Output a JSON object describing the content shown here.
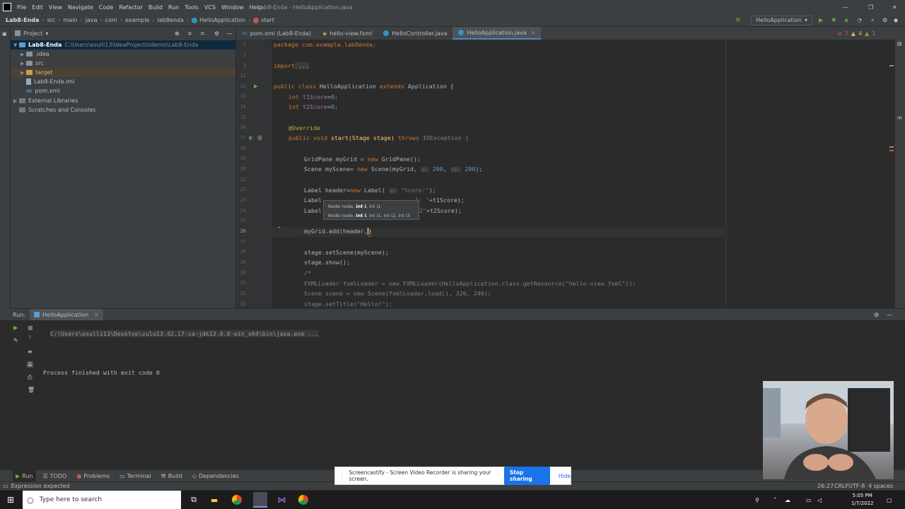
{
  "menu": [
    "File",
    "Edit",
    "View",
    "Navigate",
    "Code",
    "Refactor",
    "Build",
    "Run",
    "Tools",
    "VCS",
    "Window",
    "Help"
  ],
  "window_title": "Lab8-Enda - HelloApplication.java",
  "breadcrumbs": [
    "Lab8-Enda",
    "src",
    "main",
    "java",
    "com",
    "example",
    "lab8enda",
    "HelloApplication",
    "start"
  ],
  "run_config": "HelloApplication",
  "project": {
    "title": "Project",
    "root": "Lab8-Enda",
    "root_path": "C:\\Users\\esulli13\\IdeaProjects\\demo\\Lab8-Enda",
    "items": [
      ".idea",
      "src",
      "target",
      "Lab8-Enda.iml",
      "pom.xml"
    ],
    "external": "External Libraries",
    "scratches": "Scratches and Consoles"
  },
  "tabs": [
    "pom.xml (Lab8-Enda)",
    "hello-view.fxml",
    "HelloController.java",
    "HelloApplication.java"
  ],
  "inspections": {
    "errors": "2",
    "warnings": "4",
    "weak": "1"
  },
  "code": {
    "lines": [
      "1",
      "2",
      "3",
      "11",
      "12",
      "13",
      "14",
      "15",
      "16",
      "17",
      "18",
      "19",
      "20",
      "21",
      "22",
      "23",
      "24",
      "25",
      "26",
      "27",
      "28",
      "29",
      "30",
      "31",
      "32",
      "33"
    ],
    "l1": "package com.example.lab8enda;",
    "l3_kw": "import",
    "l3_rest": " ...",
    "l12_a": "public class ",
    "l12_b": "HelloApplication ",
    "l12_c": "extends ",
    "l12_d": "Application {",
    "l13_a": "int ",
    "l13_b": "t1Score",
    "l13_c": "=",
    "l13_d": "0",
    "l14_a": "int ",
    "l14_b": "t2Score",
    "l14_c": "=",
    "l14_d": "0",
    "l16": "@Override",
    "l17_a": "public void ",
    "l17_b": "start(Stage stage) ",
    "l17_c": "throws ",
    "l17_d": "IOException {",
    "l19_a": "GridPane myGrid = ",
    "l19_b": "new ",
    "l19_c": "GridPane();",
    "l20_a": "Scene myScene= ",
    "l20_b": "new ",
    "l20_c": "Scene(myGrid, ",
    "l20_h1": "v:",
    "l20_n1": "200",
    ", ": ", ",
    "l20_h2": "v1:",
    "l20_n2": "200",
    "l20_e": ");",
    "l22_a": "Label header=",
    "l22_b": "new ",
    "l22_c": "Label( ",
    "l22_h": "s:",
    "l22_s": "\"Score:\"",
    "l22_e": ");",
    "l23_a": "Label",
    "l23_s": "1: \"",
    "l23_e": "+t1Score);",
    "l24_a": "Label",
    "l24_s": "2\"",
    "l24_e": "+t2Score);",
    "l26_a": "myGrid.add(header,",
    "l28": "stage.setScene(myScene);",
    "l29": "stage.show();",
    "l30": "/*",
    "l31": "FXMLLoader fxmlLoader = new FXMLLoader(HelloApplication.class.getResource(\"hello-view.fxml\"));",
    "l32": "Scene scene = new Scene(fxmlLoader.load(), 320, 240);",
    "l33": "stage.setTitle(\"Hello!\");"
  },
  "tooltip": {
    "r1_a": "Node node, ",
    "r1_b": "int i",
    ", int i1": ", int i1",
    "r2_a": "Node node, ",
    "r2_b": "int i",
    "r2_c": ", int i1, int i2, int i3"
  },
  "run": {
    "label": "Run:",
    "tab": "HelloApplication",
    "cmd": "C:\\Users\\esulli13\\Desktop\\zulu13.42.17-ca-jdk13.0.8-win_x64\\bin\\java.exe ...",
    "output": "Process finished with exit code 0"
  },
  "bottom_tabs": [
    "Run",
    "TODO",
    "Problems",
    "Terminal",
    "Build",
    "Dependencies"
  ],
  "status": {
    "left": "Expression expected",
    "pos": "26:27",
    "sep": "CRLF",
    "enc": "UTF-8",
    "indent": "4 spaces"
  },
  "share": {
    "text": "Screencastify - Screen Video Recorder is sharing your screen.",
    "stop": "Stop sharing",
    "hide": "Hide"
  },
  "taskbar": {
    "search": "Type here to search",
    "time": "5:05 PM",
    "date": "1/7/2022"
  }
}
